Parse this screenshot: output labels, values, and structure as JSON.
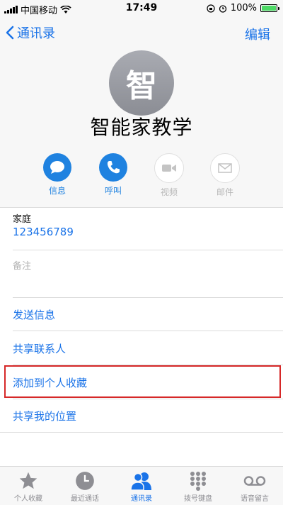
{
  "status_bar": {
    "carrier": "中国移动",
    "time": "17:49",
    "battery": "100%"
  },
  "nav": {
    "back_label": "通讯录",
    "edit_label": "编辑"
  },
  "contact": {
    "avatar_char": "智",
    "name": "智能家教学"
  },
  "actions": [
    {
      "label": "信息",
      "icon": "message-icon",
      "enabled": true
    },
    {
      "label": "呼叫",
      "icon": "phone-icon",
      "enabled": true
    },
    {
      "label": "视频",
      "icon": "video-icon",
      "enabled": false
    },
    {
      "label": "邮件",
      "icon": "mail-icon",
      "enabled": false
    }
  ],
  "details": {
    "phone_label": "家庭",
    "phone_value": "123456789",
    "note_label": "备注"
  },
  "options": [
    "发送信息",
    "共享联系人",
    "添加到个人收藏",
    "共享我的位置"
  ],
  "tabs": [
    {
      "label": "个人收藏",
      "icon": "star-icon"
    },
    {
      "label": "最近通话",
      "icon": "clock-icon"
    },
    {
      "label": "通讯录",
      "icon": "contacts-icon",
      "active": true
    },
    {
      "label": "拨号键盘",
      "icon": "keypad-icon"
    },
    {
      "label": "语音留言",
      "icon": "voicemail-icon"
    }
  ],
  "colors": {
    "accent": "#1a73e8",
    "highlight": "#d62828"
  }
}
